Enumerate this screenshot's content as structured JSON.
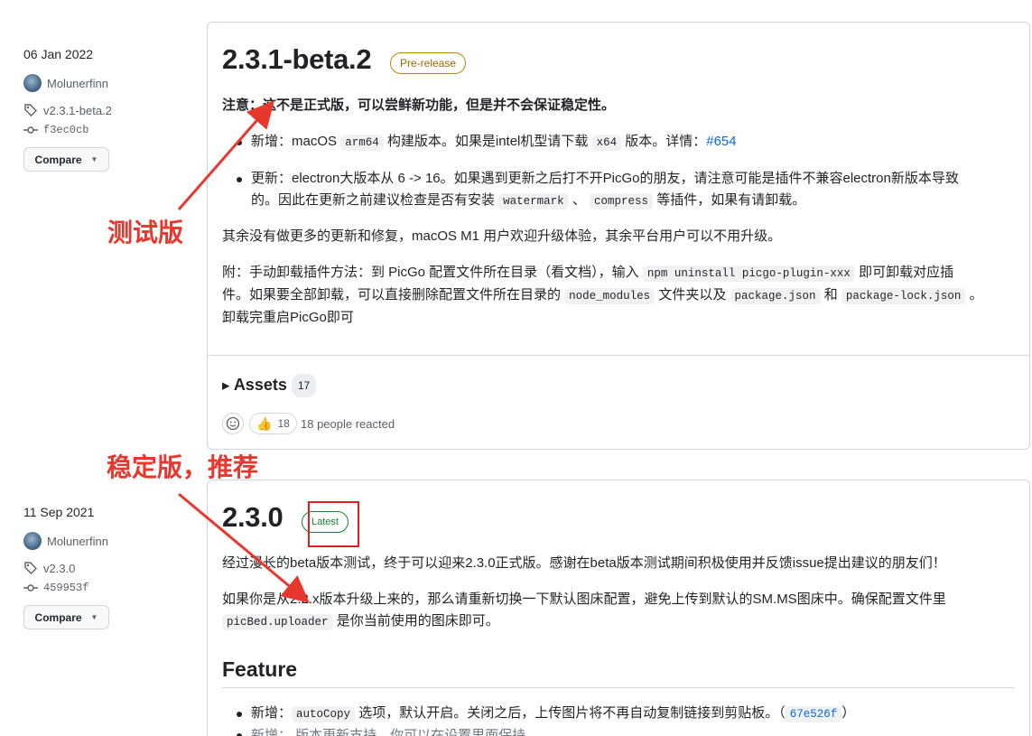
{
  "release1": {
    "date": "06 Jan 2022",
    "author": "Molunerfinn",
    "tag": "v2.3.1-beta.2",
    "commit": "f3ec0cb",
    "compare_label": "Compare",
    "version": "2.3.1-beta.2",
    "badge": "Pre-release",
    "notice": "注意：这不是正式版，可以尝鲜新功能，但是并不会保证稳定性。",
    "item1_a": "新增：macOS ",
    "item1_code1": "arm64",
    "item1_b": " 构建版本。如果是intel机型请下载 ",
    "item1_code2": "x64",
    "item1_c": " 版本。详情：",
    "item1_link": "#654",
    "item2_a": "更新：electron大版本从 6 -> 16。如果遇到更新之后打不开PicGo的朋友，请注意可能是插件不兼容electron新版本导致",
    "item2_b": "的。因此在更新之前建议检查是否有安装 ",
    "item2_code1": "watermark",
    "item2_c": " 、 ",
    "item2_code2": "compress",
    "item2_d": " 等插件，如果有请卸载。",
    "para1": "其余没有做更多的更新和修复，macOS M1 用户欢迎升级体验，其余平台用户可以不用升级。",
    "para2_a": "附：手动卸载插件方法：到 PicGo 配置文件所在目录（看文档），输入 ",
    "para2_code1": "npm uninstall picgo-plugin-xxx",
    "para2_b": " 即可卸载对应插",
    "para2_c": "件。如果要全部卸载，可以直接删除配置文件所在目录的 ",
    "para2_code2": "node_modules",
    "para2_d": " 文件夹以及 ",
    "para2_code3": "package.json",
    "para2_e": " 和 ",
    "para2_code4": "package-lock.json",
    "para2_f": " 。",
    "para2_g": "卸载完重启PicGo即可",
    "assets_label": "Assets",
    "assets_count": "17",
    "reaction_count": "18",
    "reacted_text": "18 people reacted"
  },
  "release2": {
    "date": "11 Sep 2021",
    "author": "Molunerfinn",
    "tag": "v2.3.0",
    "commit": "459953f",
    "compare_label": "Compare",
    "version": "2.3.0",
    "badge": "Latest",
    "para1": "经过漫长的beta版本测试，终于可以迎来2.3.0正式版。感谢在beta版本测试期间积极使用并反馈issue提出建议的朋友们！",
    "para2_a": "如果你是从2.2.x版本升级上来的，那么请重新切换一下默认图床配置，避免上传到默认的SM.MS图床中。确保配置文件里",
    "para2_code": "picBed.uploader",
    "para2_b": " 是你当前使用的图床即可。",
    "feature_heading": "Feature",
    "item1_a": "新增：",
    "item1_code": "autoCopy",
    "item1_b": " 选项，默认开启。关闭之后，上传图片将不再自动复制链接到剪贴板。（",
    "item1_link": "67e526f",
    "item1_c": "）",
    "item2_partial": "新增：        版本更新支持，你可以在设置里面保持......"
  },
  "annotations": {
    "beta_label": "测试版",
    "stable_label": "稳定版，推荐",
    "color": "#e8382e"
  }
}
